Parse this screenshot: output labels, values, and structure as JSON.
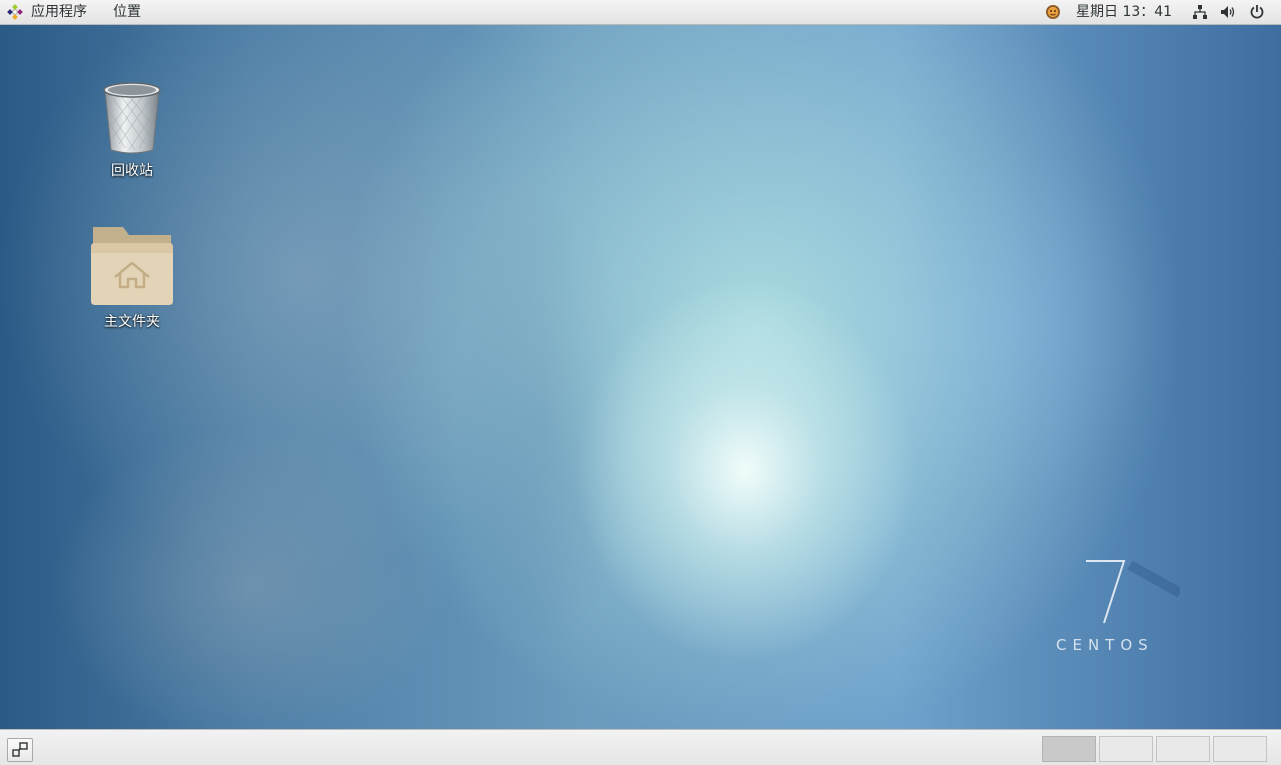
{
  "top_panel": {
    "apps_menu_label": "应用程序",
    "places_menu_label": "位置",
    "clock": "星期日 13：41",
    "icons": {
      "apps_logo": "centos-logo-icon",
      "notification": "user-avatar-icon",
      "network": "network-wired-icon",
      "volume": "speaker-volume-icon",
      "power": "power-icon"
    }
  },
  "desktop": {
    "icons": [
      {
        "label": "回收站",
        "icon": "trash-icon"
      },
      {
        "label": "主文件夹",
        "icon": "home-folder-icon"
      }
    ],
    "wallpaper": {
      "number": "7",
      "brand": "CENTOS"
    }
  },
  "bottom_panel": {
    "show_desktop_icon": "show-desktop-icon",
    "workspaces": [
      {
        "active": true
      },
      {
        "active": false
      },
      {
        "active": false
      },
      {
        "active": false
      }
    ]
  },
  "colors": {
    "panel_bg": "#ececec",
    "panel_text": "#2e3436",
    "folder": "#d8c7a5"
  }
}
